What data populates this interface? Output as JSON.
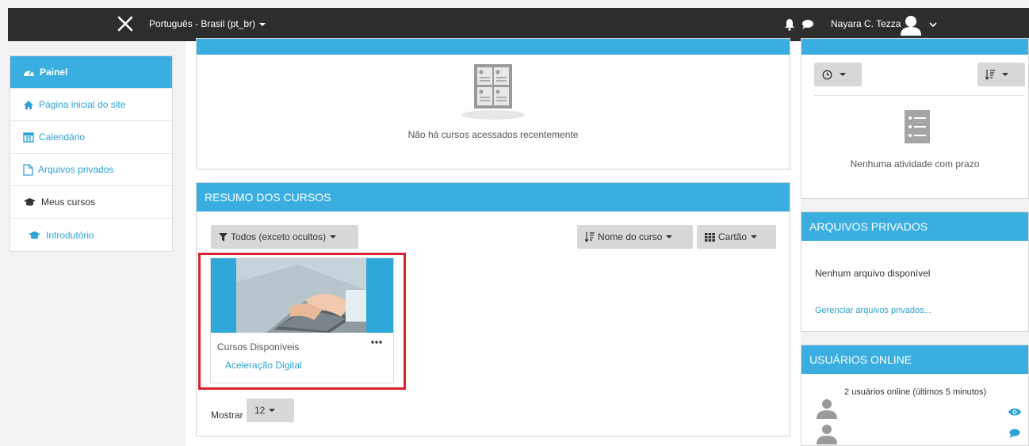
{
  "navbar": {
    "language": "Português - Brasil (pt_br)",
    "user_name": "Nayara C. Tezza"
  },
  "sidebar": {
    "items": [
      {
        "label": "Painel"
      },
      {
        "label": "Página inicial do site"
      },
      {
        "label": "Calendário"
      },
      {
        "label": "Arquivos privados"
      },
      {
        "label": "Meus cursos"
      },
      {
        "label": "Introdutório"
      }
    ]
  },
  "recent": {
    "empty_text": "Não há cursos acessados recentemente"
  },
  "resumo": {
    "title": "RESUMO DOS CURSOS",
    "filter_label": "Todos (exceto ocultos)",
    "sort_label": "Nome do curso",
    "view_label": "Cartão",
    "course": {
      "category": "Cursos Disponíveis",
      "name": "Aceleração Digital"
    },
    "show_label": "Mostrar",
    "show_value": "12"
  },
  "timeline": {
    "empty_text": "Nenhuma atividade com prazo"
  },
  "private_files": {
    "title": "ARQUIVOS PRIVADOS",
    "empty_text": "Nenhum arquivo disponível",
    "manage_link": "Gerenciar arquivos privados..."
  },
  "online_users": {
    "title": "USUÁRIOS ONLINE",
    "summary": "2 usuários online (últimos 5 minutos)"
  },
  "colors": {
    "accent": "#3aaee0",
    "navbar": "#2d2d2d",
    "link": "#2ea2d6",
    "highlight": "#d9232a"
  }
}
